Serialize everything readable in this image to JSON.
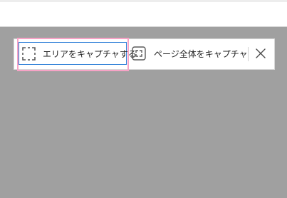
{
  "toolbar": {
    "area_capture_label": "エリアをキャプチャする",
    "area_capture_icon": "select-area-icon",
    "full_page_label": "ページ全体をキャプチャ",
    "full_page_icon": "capture-full-page-icon",
    "close_icon": "close-icon"
  },
  "colors": {
    "overlay": "#a0a0a0",
    "focus_border": "#2f80d8",
    "highlight_border": "#f7a3c6"
  }
}
